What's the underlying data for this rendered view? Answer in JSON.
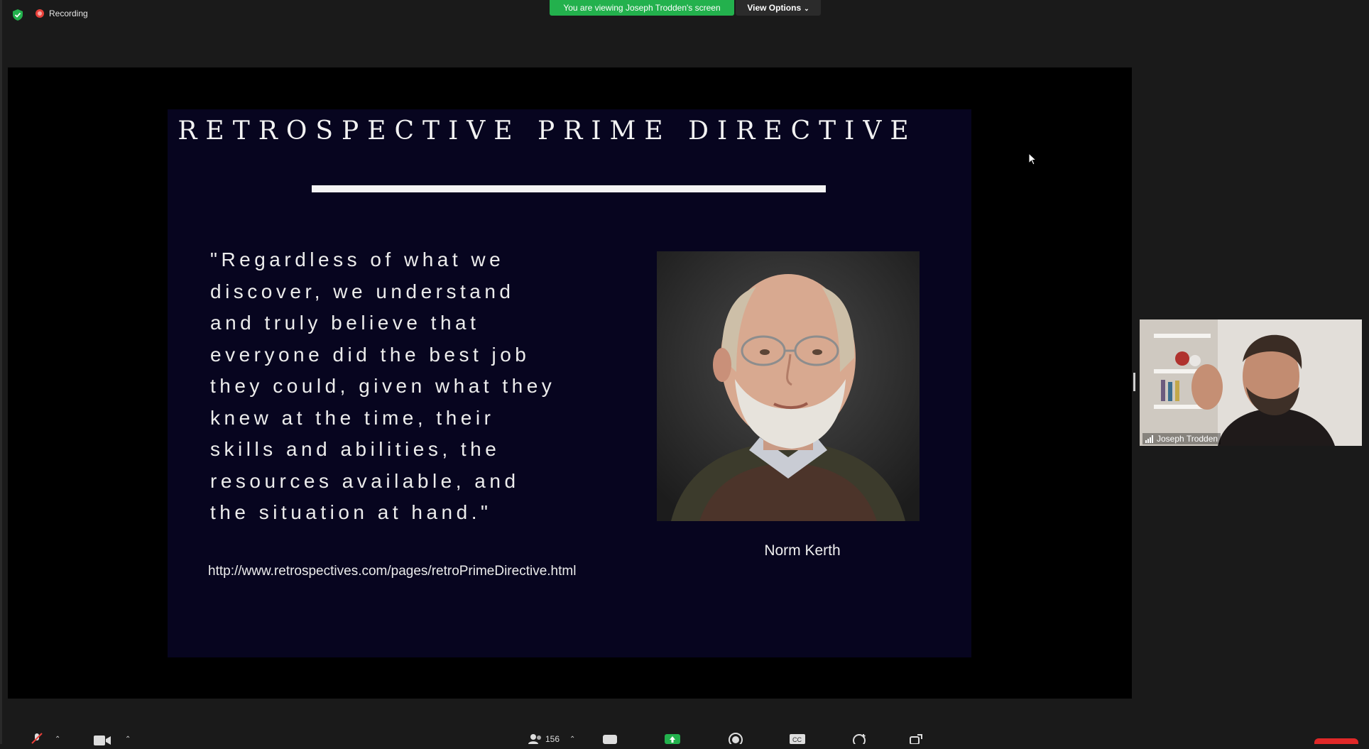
{
  "topbar": {
    "recording_label": "Recording",
    "viewing_banner": "You are viewing Joseph Trodden's screen",
    "view_options_label": "View Options"
  },
  "slide": {
    "title": "RETROSPECTIVE PRIME DIRECTIVE",
    "quote": "\"Regardless of what we\ndiscover, we understand\nand truly believe that\neveryone did the best job\nthey could, given what they\nknew at the time, their\nskills and abilities, the\nresources available, and\nthe situation at hand.\"",
    "author": "Norm Kerth",
    "url": "http://www.retrospectives.com/pages/retroPrimeDirective.html"
  },
  "participant": {
    "name": "Joseph Trodden"
  },
  "toolbar": {
    "participants_count": "156"
  },
  "colors": {
    "banner_green": "#23b14d",
    "slide_background": "#07051f",
    "recording_red": "#e8403a",
    "end_button_red": "#e02828"
  },
  "icons": [
    "shield-check-icon",
    "recording-icon",
    "chevron-down-icon",
    "signal-bars-icon",
    "mute-mic-icon",
    "video-camera-icon",
    "participants-icon",
    "chat-icon",
    "share-screen-icon",
    "record-icon",
    "closed-caption-icon",
    "reactions-icon",
    "apps-icon",
    "mouse-cursor-icon"
  ]
}
